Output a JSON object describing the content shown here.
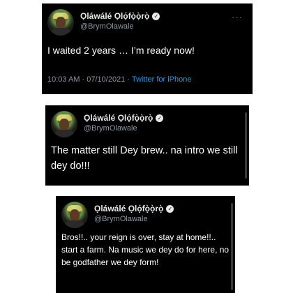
{
  "tweets": [
    {
      "name": "Ọláwálé Ọlọ́fọ̀ọ̀rọ̀",
      "handle": "@BrymOlawale",
      "text": "I waited 2 years … I’m ready now!",
      "time": "10:03 AM · 07/10/2021 ·",
      "source": "Twitter for iPhone"
    },
    {
      "name": "Ọláwálé Ọlọ́fọ̀ọ̀rọ̀",
      "handle": "@BrymOlawale",
      "text": "The matter still Dey brew.. na intro we still dey do!!!"
    },
    {
      "name": "Ọláwálé Ọlọ́fọ̀ọ̀rọ̀",
      "handle": "@BrymOlawale",
      "text": "Bros!!.. your reign is over, stay at home!!.. start a farm. Na music we dey do for here, no be godfather we dey form!"
    }
  ],
  "icons": {
    "verified": "verified-badge-icon",
    "more": "more-options-icon",
    "avatar": "profile-avatar"
  },
  "colors": {
    "card_bg": "#000000",
    "text": "#ffffff",
    "muted": "#8b98a5",
    "link": "#1d9bf0"
  },
  "glyphs": {
    "more": "···",
    "check": "✓"
  }
}
